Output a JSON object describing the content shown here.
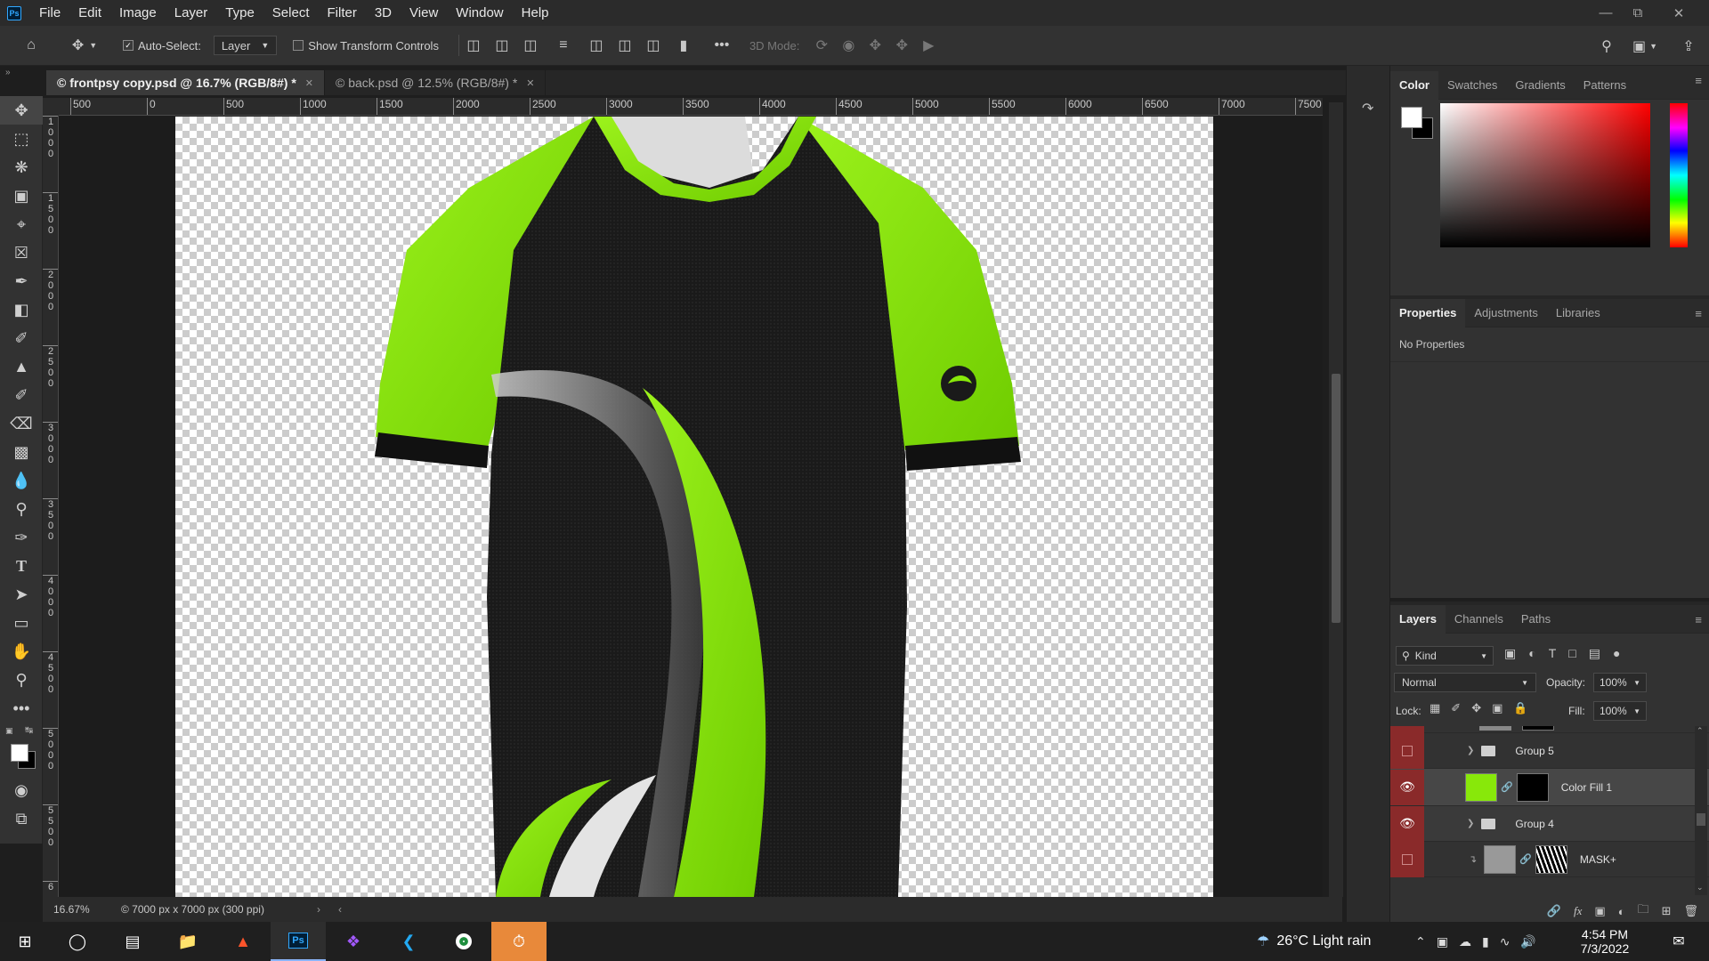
{
  "app": {
    "logo": "Ps"
  },
  "menu": [
    "File",
    "Edit",
    "Image",
    "Layer",
    "Type",
    "Select",
    "Filter",
    "3D",
    "View",
    "Window",
    "Help"
  ],
  "options": {
    "auto_select_label": "Auto-Select:",
    "auto_select_value": "Layer",
    "transform_label": "Show Transform Controls",
    "mode_3d_label": "3D Mode:"
  },
  "tabs": [
    {
      "label": "© frontpsy copy.psd @ 16.7% (RGB/8#) *",
      "active": true
    },
    {
      "label": "© back.psd @ 12.5% (RGB/8#) *",
      "active": false
    }
  ],
  "ruler_top": [
    "500",
    "0",
    "500",
    "1000",
    "1500",
    "2000",
    "2500",
    "3000",
    "3500",
    "4000",
    "4500",
    "5000",
    "5500",
    "6000",
    "6500",
    "7000",
    "7500"
  ],
  "ruler_left": [
    "1\n0\n0\n0",
    "1\n5\n0\n0",
    "2\n0\n0\n0",
    "2\n5\n0\n0",
    "3\n0\n0\n0",
    "3\n5\n0\n0",
    "4\n0\n0\n0",
    "4\n5\n0\n0",
    "5\n0\n0\n0",
    "5\n5\n0\n0",
    "6"
  ],
  "status": {
    "zoom": "16.67%",
    "doc_info": "© 7000 px x 7000 px (300 ppi)"
  },
  "color_panel": {
    "tabs": [
      "Color",
      "Swatches",
      "Gradients",
      "Patterns"
    ],
    "foreground": "#ffffff",
    "background": "#000000"
  },
  "properties_panel": {
    "tabs": [
      "Properties",
      "Adjustments",
      "Libraries"
    ],
    "empty_text": "No Properties"
  },
  "layers_panel": {
    "tabs": [
      "Layers",
      "Channels",
      "Paths"
    ],
    "kind_label": "Kind",
    "blend_mode": "Normal",
    "opacity_label": "Opacity:",
    "opacity_value": "100%",
    "lock_label": "Lock:",
    "fill_label": "Fill:",
    "fill_value": "100%",
    "layers": [
      {
        "name": "Group 5",
        "type": "group",
        "visible": false
      },
      {
        "name": "Color Fill 1",
        "type": "fill",
        "visible": true,
        "selected": true,
        "color": "#88e80a"
      },
      {
        "name": "Group 4",
        "type": "group",
        "visible": true
      },
      {
        "name": "MASK+",
        "type": "mask",
        "visible": false
      }
    ]
  },
  "taskbar": {
    "weather": "26°C  Light rain",
    "time": "4:54 PM",
    "date": "7/3/2022"
  },
  "colors": {
    "jersey_green": "#88e80a",
    "jersey_black": "#1a1a1a",
    "ps_blue": "#31a8ff"
  }
}
